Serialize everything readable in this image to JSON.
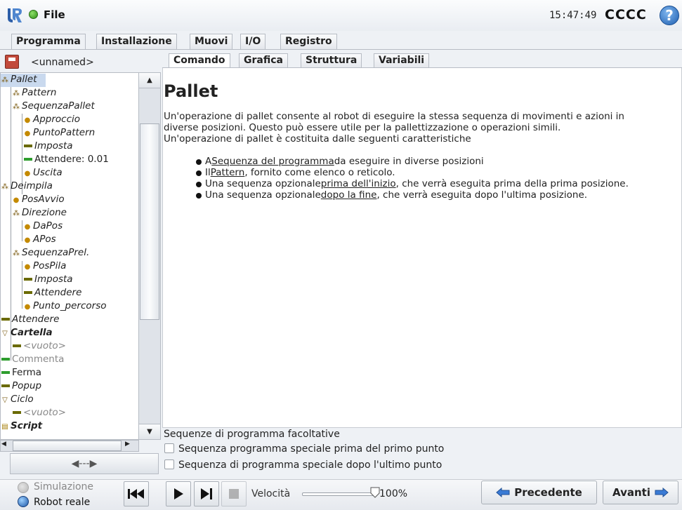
{
  "header": {
    "file_label": "File",
    "clock": "15:47:49",
    "robot_name": "CCCC",
    "help_glyph": "?"
  },
  "main_tabs": [
    {
      "label": "Programma",
      "active": true
    },
    {
      "label": "Installazione",
      "active": false
    },
    {
      "label": "Muovi",
      "active": false
    },
    {
      "label": "I/O",
      "active": false
    },
    {
      "label": "Registro",
      "active": false
    }
  ],
  "program": {
    "name": "<unnamed>"
  },
  "tree": [
    {
      "label": "Pallet",
      "icon": "pallet-icon",
      "italic": true,
      "selected": true
    },
    {
      "label": "Pattern",
      "icon": "pallet-icon",
      "italic": true
    },
    {
      "label": "SequenzaPallet",
      "icon": "pallet-icon",
      "italic": true
    },
    {
      "label": "Approccio",
      "icon": "waypoint-icon",
      "italic": true
    },
    {
      "label": "PuntoPattern",
      "icon": "waypoint-icon",
      "italic": true
    },
    {
      "label": "Imposta",
      "icon": "set-icon",
      "italic": true
    },
    {
      "label": "Attendere: 0.01",
      "icon": "wait-icon",
      "italic": false
    },
    {
      "label": "Uscita",
      "icon": "waypoint-icon",
      "italic": true
    },
    {
      "label": "Deimpila",
      "icon": "pallet-icon",
      "italic": true
    },
    {
      "label": "PosAvvio",
      "icon": "waypoint-icon",
      "italic": true
    },
    {
      "label": "Direzione",
      "icon": "pallet-icon",
      "italic": true
    },
    {
      "label": "DaPos",
      "icon": "waypoint-icon",
      "italic": true
    },
    {
      "label": "APos",
      "icon": "waypoint-icon",
      "italic": true
    },
    {
      "label": "SequenzaPrel.",
      "icon": "pallet-icon",
      "italic": true
    },
    {
      "label": "PosPila",
      "icon": "waypoint-icon",
      "italic": true
    },
    {
      "label": "Imposta",
      "icon": "set-icon",
      "italic": true
    },
    {
      "label": "Attendere",
      "icon": "set-icon",
      "italic": true
    },
    {
      "label": "Punto_percorso",
      "icon": "waypoint-icon",
      "italic": true
    },
    {
      "label": "Attendere",
      "icon": "set-icon",
      "italic": true
    },
    {
      "label": "Cartella",
      "icon": "folder-icon",
      "italic": true
    },
    {
      "label": "<vuoto>",
      "icon": "set-icon",
      "italic": true
    },
    {
      "label": "Commenta",
      "icon": "wait-icon",
      "italic": false
    },
    {
      "label": "Ferma",
      "icon": "wait-icon",
      "italic": false
    },
    {
      "label": "Popup",
      "icon": "set-icon",
      "italic": true
    },
    {
      "label": "Ciclo",
      "icon": "folder-icon",
      "italic": true
    },
    {
      "label": "<vuoto>",
      "icon": "set-icon",
      "italic": true
    },
    {
      "label": "Script",
      "icon": "script-icon",
      "italic": true
    }
  ],
  "sub_tabs": [
    {
      "label": "Comando",
      "active": true
    },
    {
      "label": "Grafica",
      "active": false
    },
    {
      "label": "Struttura",
      "active": false
    },
    {
      "label": "Variabili",
      "active": false
    }
  ],
  "content": {
    "title": "Pallet",
    "intro_line1": "Un'operazione di pallet consente al robot di eseguire la stessa sequenza di movimenti e azioni in",
    "intro_line2": "diverse posizioni. Questo può essere utile per la pallettizzazione o operazioni simili.",
    "intro_line3": "Un'operazione di pallet è costituita dalle seguenti caratteristiche",
    "bullets": [
      {
        "pre": "A ",
        "link": "Sequenza del programma",
        "post": " da eseguire in diverse posizioni"
      },
      {
        "pre": "Il ",
        "link": "Pattern",
        "post": ", fornito come elenco o reticolo."
      },
      {
        "pre": "Una sequenza opzionale ",
        "link": "prima dell'inizio",
        "post": ", che verrà eseguita prima della prima posizione."
      },
      {
        "pre": "Una sequenza opzionale ",
        "link": "dopo la fine",
        "post": ", che verrà eseguita dopo l'ultima posizione."
      }
    ],
    "optional_label": "Sequenze di programma facoltative",
    "checkbox_before": "Sequenza programma speciale prima del primo punto",
    "checkbox_after": "Sequenza di programma speciale dopo l'ultimo punto"
  },
  "footer": {
    "sim_label": "Simulazione",
    "real_label": "Robot reale",
    "speed_label": "Velocità",
    "speed_value": "100%",
    "speed_fraction": 1.0,
    "prev_label": "Precedente",
    "next_label": "Avanti"
  },
  "colors": {
    "accent_green": "#2e9d2e",
    "waypoint": "#c48a00",
    "selected_row": "#c9d9ee",
    "robot_real_blue": "#1c56a6"
  }
}
